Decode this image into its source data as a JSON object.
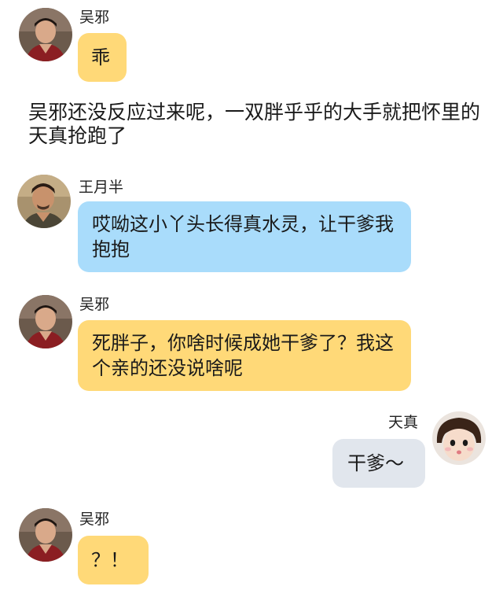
{
  "messages": [
    {
      "sender": "吴邪",
      "text": "乖",
      "bubble": "yellow"
    },
    {
      "sender": "王月半",
      "text": "哎呦这小丫头长得真水灵，让干爹我抱抱",
      "bubble": "blue"
    },
    {
      "sender": "吴邪",
      "text": "死胖子，你啥时候成她干爹了？我这个亲的还没说啥呢",
      "bubble": "yellow"
    },
    {
      "sender": "天真",
      "text": "干爹～",
      "bubble": "grey"
    },
    {
      "sender": "吴邪",
      "text": "？！",
      "bubble": "yellow"
    }
  ],
  "narration": "吴邪还没反应过来呢，一双胖乎乎的大手就把怀里的天真抢跑了",
  "colors": {
    "yellow_bubble": "#ffd978",
    "blue_bubble": "#a9dcfb",
    "grey_bubble": "#e1e6ed"
  },
  "icons": {
    "wuxie": "man-portrait-avatar",
    "wangyueban": "man-portrait-avatar",
    "tianzhen": "girl-portrait-avatar"
  }
}
